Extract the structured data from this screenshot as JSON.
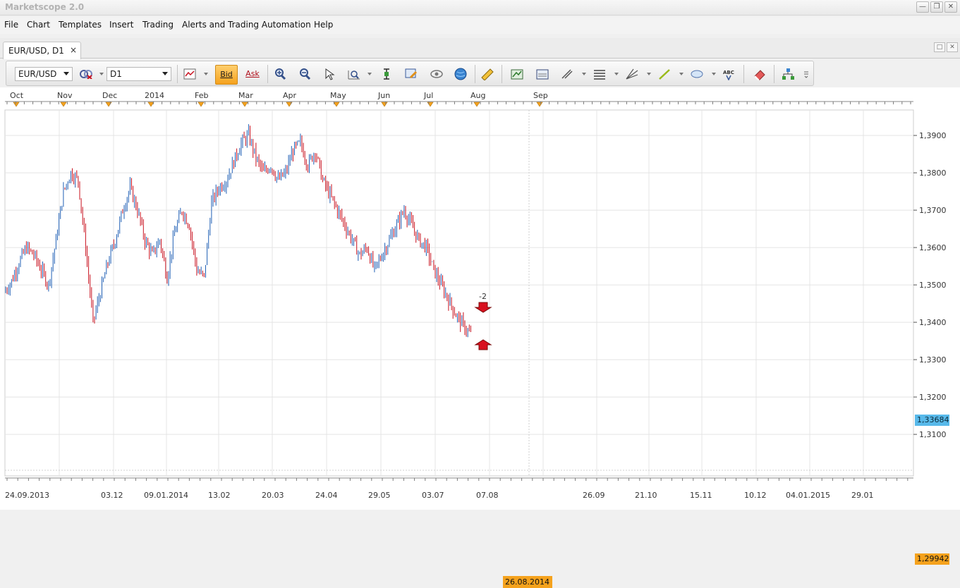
{
  "window": {
    "title": "Marketscope 2.0"
  },
  "menu": [
    "File",
    "Chart",
    "Templates",
    "Insert",
    "Trading",
    "Alerts and Trading Automation",
    "Help"
  ],
  "tab": {
    "label": "EUR/USD, D1",
    "close": "×"
  },
  "toolbar": {
    "symbol": "EUR/USD",
    "timeframe": "D1",
    "bid_label": "Bid",
    "ask_label": "Ask",
    "active_price": "Bid"
  },
  "chart_data": {
    "type": "candlestick",
    "instrument": "EUR/USD",
    "timeframe": "D1",
    "month_labels": [
      "Oct",
      "Nov",
      "Dec",
      "2014",
      "Feb",
      "Mar",
      "Apr",
      "May",
      "Jun",
      "Jul",
      "Aug",
      "Sep"
    ],
    "date_labels": [
      "24.09.2013",
      "03.12",
      "09.01.2014",
      "13.02",
      "20.03",
      "24.04",
      "29.05",
      "03.07",
      "07.08",
      "26.08.2014",
      "26.09",
      "21.10",
      "15.11",
      "10.12",
      "04.01.2015",
      "29.01"
    ],
    "price_labels": [
      "1,3900",
      "1,3800",
      "1,3700",
      "1,3600",
      "1,3500",
      "1,3400",
      "1,3300",
      "1,3200",
      "1,3100"
    ],
    "ylim": [
      1.2994,
      1.397
    ],
    "grid": true,
    "current_price": "1,33684",
    "lowest_visible_price": "1,29942",
    "current_date": "26.08.2014",
    "trade_marker_label": "-2",
    "colors": {
      "up": "#1f5fb5",
      "down": "#c8101e",
      "price_tag": "#58b9ea",
      "highlight": "#f5a21d"
    },
    "closes": [
      1.348,
      1.351,
      1.356,
      1.36,
      1.358,
      1.354,
      1.35,
      1.362,
      1.375,
      1.38,
      1.378,
      1.36,
      1.34,
      1.348,
      1.356,
      1.362,
      1.37,
      1.376,
      1.37,
      1.362,
      1.358,
      1.362,
      1.352,
      1.364,
      1.37,
      1.366,
      1.354,
      1.352,
      1.372,
      1.376,
      1.378,
      1.383,
      1.388,
      1.39,
      1.384,
      1.38,
      1.382,
      1.378,
      1.38,
      1.386,
      1.388,
      1.382,
      1.386,
      1.378,
      1.374,
      1.37,
      1.366,
      1.362,
      1.358,
      1.36,
      1.354,
      1.358,
      1.362,
      1.366,
      1.37,
      1.366,
      1.362,
      1.36,
      1.354,
      1.35,
      1.346,
      1.342,
      1.339,
      1.3368
    ]
  },
  "trade_markers": {
    "sell": "sell-arrow",
    "buy": "buy-arrow"
  }
}
